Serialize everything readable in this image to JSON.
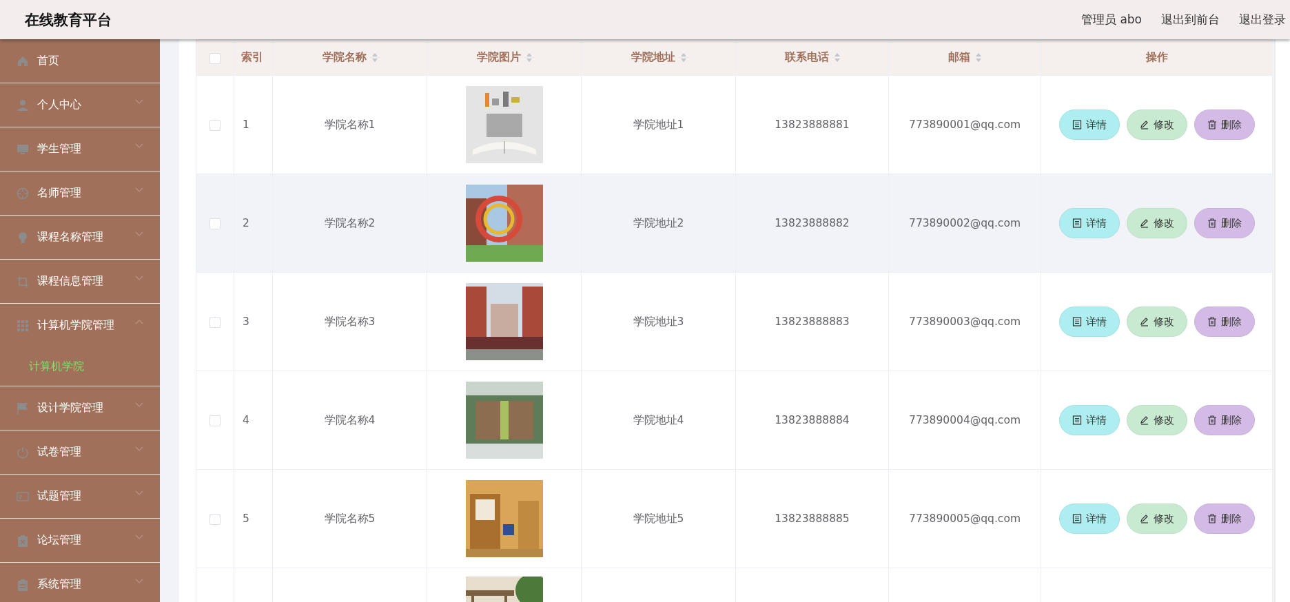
{
  "header": {
    "title": "在线教育平台",
    "links": [
      "管理员 abo",
      "退出到前台",
      "退出登录"
    ]
  },
  "sidebar": {
    "items": [
      {
        "label": "首页",
        "kind": "link"
      },
      {
        "label": "个人中心",
        "kind": "menu",
        "expanded": false
      },
      {
        "label": "学生管理",
        "kind": "menu",
        "expanded": false
      },
      {
        "label": "名师管理",
        "kind": "menu",
        "expanded": false
      },
      {
        "label": "课程名称管理",
        "kind": "menu",
        "expanded": false
      },
      {
        "label": "课程信息管理",
        "kind": "menu",
        "expanded": false
      },
      {
        "label": "计算机学院管理",
        "kind": "menu",
        "expanded": true,
        "children": [
          {
            "label": "计算机学院",
            "selected": true
          }
        ]
      },
      {
        "label": "设计学院管理",
        "kind": "menu",
        "expanded": false
      },
      {
        "label": "试卷管理",
        "kind": "menu",
        "expanded": false
      },
      {
        "label": "试题管理",
        "kind": "menu",
        "expanded": false
      },
      {
        "label": "论坛管理",
        "kind": "menu",
        "expanded": false
      },
      {
        "label": "系统管理",
        "kind": "menu",
        "expanded": false
      }
    ]
  },
  "table": {
    "all_checked": false,
    "columns": [
      {
        "label": "索引",
        "sortable": false
      },
      {
        "label": "学院名称",
        "sortable": true
      },
      {
        "label": "学院图片",
        "sortable": true
      },
      {
        "label": "学院地址",
        "sortable": true
      },
      {
        "label": "联系电话",
        "sortable": true
      },
      {
        "label": "邮箱",
        "sortable": true
      },
      {
        "label": "操作",
        "sortable": false
      }
    ],
    "rows": [
      {
        "checked": false,
        "highlighted": false,
        "index": "1",
        "name": "学院名称1",
        "address": "学院地址1",
        "phone": "13823888881",
        "email": "773890001@qq.com",
        "actions": [
          {
            "kind": "detail",
            "label": "详情"
          },
          {
            "kind": "edit",
            "label": "修改"
          },
          {
            "kind": "delete",
            "label": "删除"
          }
        ]
      },
      {
        "checked": false,
        "highlighted": true,
        "index": "2",
        "name": "学院名称2",
        "address": "学院地址2",
        "phone": "13823888882",
        "email": "773890002@qq.com",
        "actions": [
          {
            "kind": "detail",
            "label": "详情"
          },
          {
            "kind": "edit",
            "label": "修改"
          },
          {
            "kind": "delete",
            "label": "删除"
          }
        ]
      },
      {
        "checked": false,
        "highlighted": false,
        "index": "3",
        "name": "学院名称3",
        "address": "学院地址3",
        "phone": "13823888883",
        "email": "773890003@qq.com",
        "actions": [
          {
            "kind": "detail",
            "label": "详情"
          },
          {
            "kind": "edit",
            "label": "修改"
          },
          {
            "kind": "delete",
            "label": "删除"
          }
        ]
      },
      {
        "checked": false,
        "highlighted": false,
        "index": "4",
        "name": "学院名称4",
        "address": "学院地址4",
        "phone": "13823888884",
        "email": "773890004@qq.com",
        "actions": [
          {
            "kind": "detail",
            "label": "详情"
          },
          {
            "kind": "edit",
            "label": "修改"
          },
          {
            "kind": "delete",
            "label": "删除"
          }
        ]
      },
      {
        "checked": false,
        "highlighted": false,
        "index": "5",
        "name": "学院名称5",
        "address": "学院地址5",
        "phone": "13823888885",
        "email": "773890005@qq.com",
        "actions": [
          {
            "kind": "detail",
            "label": "详情"
          },
          {
            "kind": "edit",
            "label": "修改"
          },
          {
            "kind": "delete",
            "label": "删除"
          }
        ]
      }
    ]
  }
}
